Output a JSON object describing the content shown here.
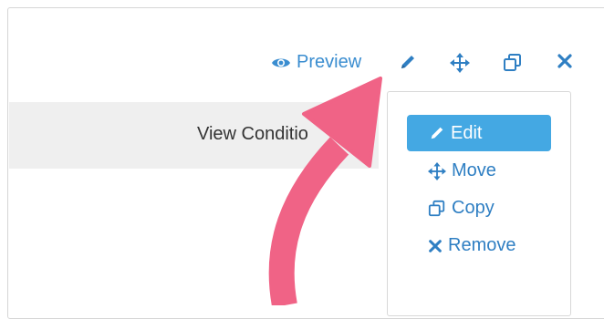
{
  "toolbar": {
    "preview_label": "Preview",
    "icons": [
      "eye-icon",
      "pencil-icon",
      "move-icon",
      "copy-icon",
      "close-icon"
    ]
  },
  "content": {
    "bar_text": "View Conditio"
  },
  "menu": {
    "items": [
      {
        "label": "Edit",
        "icon": "pencil-icon",
        "active": true
      },
      {
        "label": "Move",
        "icon": "move-icon",
        "active": false
      },
      {
        "label": "Copy",
        "icon": "copy-icon",
        "active": false
      },
      {
        "label": "Remove",
        "icon": "close-icon",
        "active": false
      }
    ]
  },
  "colors": {
    "link_blue": "#2f7fc3",
    "active_bg": "#44a8e3",
    "annotation_arrow": "#f06386"
  }
}
